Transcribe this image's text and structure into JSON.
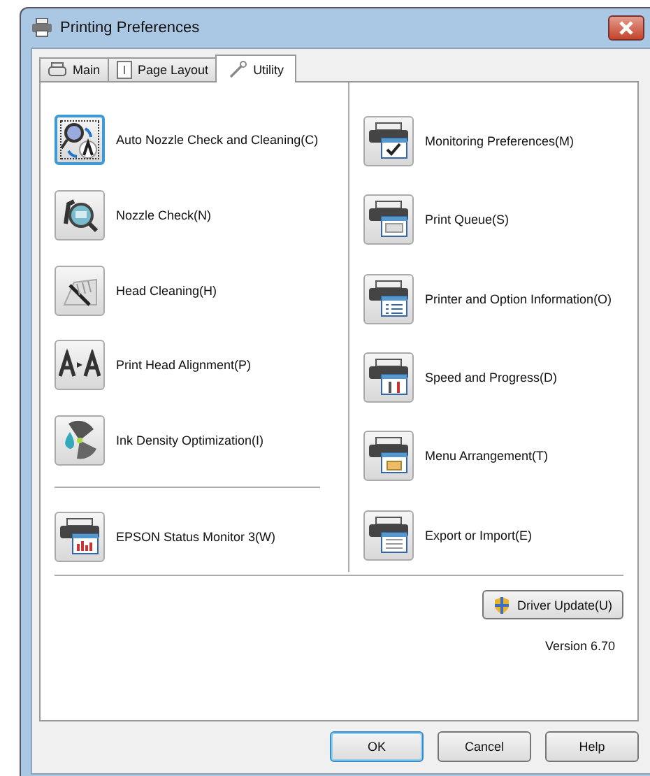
{
  "window": {
    "title": "Printing Preferences"
  },
  "tabs": [
    {
      "label": "Main",
      "selected": false
    },
    {
      "label": "Page Layout",
      "selected": false
    },
    {
      "label": "Utility",
      "selected": true
    }
  ],
  "left_items": [
    {
      "label": "Auto Nozzle Check and Cleaning(C)",
      "focused": true
    },
    {
      "label": "Nozzle Check(N)",
      "focused": false
    },
    {
      "label": "Head Cleaning(H)",
      "focused": false
    },
    {
      "label": "Print Head Alignment(P)",
      "focused": false
    },
    {
      "label": "Ink Density Optimization(I)",
      "focused": false
    }
  ],
  "status_monitor": {
    "label": "EPSON Status Monitor 3(W)"
  },
  "right_items": [
    {
      "label": "Monitoring Preferences(M)"
    },
    {
      "label": "Print Queue(S)"
    },
    {
      "label": "Printer and Option Information(O)"
    },
    {
      "label": "Speed and Progress(D)"
    },
    {
      "label": "Menu Arrangement(T)"
    },
    {
      "label": "Export or Import(E)"
    }
  ],
  "driver_update": {
    "label": "Driver Update(U)"
  },
  "version": "Version 6.70",
  "buttons": [
    "OK",
    "Cancel",
    "Help"
  ]
}
